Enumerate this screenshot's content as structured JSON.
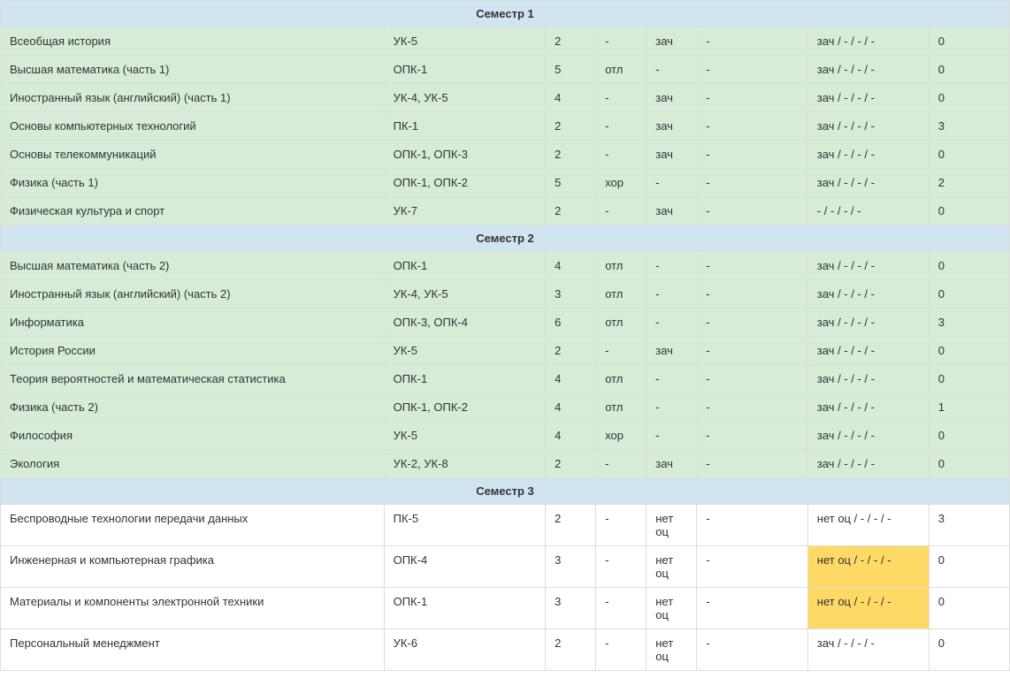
{
  "semesters": [
    {
      "title": "Семестр 1",
      "row_class": "green",
      "rows": [
        {
          "discipline": "Всеобщая история",
          "competence": "УК-5",
          "credits": "2",
          "exam": "-",
          "zach": "зач",
          "extra": "-",
          "summary": "зач / - / - / -",
          "num": "0",
          "summary_highlight": false
        },
        {
          "discipline": "Высшая математика (часть 1)",
          "competence": "ОПК-1",
          "credits": "5",
          "exam": "отл",
          "zach": "-",
          "extra": "-",
          "summary": "зач / - / - / -",
          "num": "0",
          "summary_highlight": false
        },
        {
          "discipline": "Иностранный язык (английский) (часть 1)",
          "competence": "УК-4, УК-5",
          "credits": "4",
          "exam": "-",
          "zach": "зач",
          "extra": "-",
          "summary": "зач / - / - / -",
          "num": "0",
          "summary_highlight": false
        },
        {
          "discipline": "Основы компьютерных технологий",
          "competence": "ПК-1",
          "credits": "2",
          "exam": "-",
          "zach": "зач",
          "extra": "-",
          "summary": "зач / - / - / -",
          "num": "3",
          "summary_highlight": false
        },
        {
          "discipline": "Основы телекоммуникаций",
          "competence": "ОПК-1, ОПК-3",
          "credits": "2",
          "exam": "-",
          "zach": "зач",
          "extra": "-",
          "summary": "зач / - / - / -",
          "num": "0",
          "summary_highlight": false
        },
        {
          "discipline": "Физика (часть 1)",
          "competence": "ОПК-1, ОПК-2",
          "credits": "5",
          "exam": "хор",
          "zach": "-",
          "extra": "-",
          "summary": "зач / - / - / -",
          "num": "2",
          "summary_highlight": false
        },
        {
          "discipline": "Физическая культура и спорт",
          "competence": "УК-7",
          "credits": "2",
          "exam": "-",
          "zach": "зач",
          "extra": "-",
          "summary": "- / - / - / -",
          "num": "0",
          "summary_highlight": false
        }
      ]
    },
    {
      "title": "Семестр 2",
      "row_class": "green",
      "rows": [
        {
          "discipline": "Высшая математика (часть 2)",
          "competence": "ОПК-1",
          "credits": "4",
          "exam": "отл",
          "zach": "-",
          "extra": "-",
          "summary": "зач / - / - / -",
          "num": "0",
          "summary_highlight": false
        },
        {
          "discipline": "Иностранный язык (английский) (часть 2)",
          "competence": "УК-4, УК-5",
          "credits": "3",
          "exam": "отл",
          "zach": "-",
          "extra": "-",
          "summary": "зач / - / - / -",
          "num": "0",
          "summary_highlight": false
        },
        {
          "discipline": "Информатика",
          "competence": "ОПК-3, ОПК-4",
          "credits": "6",
          "exam": "отл",
          "zach": "-",
          "extra": "-",
          "summary": "зач / - / - / -",
          "num": "3",
          "summary_highlight": false
        },
        {
          "discipline": "История России",
          "competence": "УК-5",
          "credits": "2",
          "exam": "-",
          "zach": "зач",
          "extra": "-",
          "summary": "зач / - / - / -",
          "num": "0",
          "summary_highlight": false
        },
        {
          "discipline": "Теория вероятностей и математическая статистика",
          "competence": "ОПК-1",
          "credits": "4",
          "exam": "отл",
          "zach": "-",
          "extra": "-",
          "summary": "зач / - / - / -",
          "num": "0",
          "summary_highlight": false
        },
        {
          "discipline": "Физика (часть 2)",
          "competence": "ОПК-1, ОПК-2",
          "credits": "4",
          "exam": "отл",
          "zach": "-",
          "extra": "-",
          "summary": "зач / - / - / -",
          "num": "1",
          "summary_highlight": false
        },
        {
          "discipline": "Философия",
          "competence": "УК-5",
          "credits": "4",
          "exam": "хор",
          "zach": "-",
          "extra": "-",
          "summary": "зач / - / - / -",
          "num": "0",
          "summary_highlight": false
        },
        {
          "discipline": "Экология",
          "competence": "УК-2, УК-8",
          "credits": "2",
          "exam": "-",
          "zach": "зач",
          "extra": "-",
          "summary": "зач / - / - / -",
          "num": "0",
          "summary_highlight": false
        }
      ]
    },
    {
      "title": "Семестр 3",
      "row_class": "white",
      "rows": [
        {
          "discipline": "Беспроводные технологии передачи данных",
          "competence": "ПК-5",
          "credits": "2",
          "exam": "-",
          "zach": "нет оц",
          "extra": "-",
          "summary": "нет оц / - / - / -",
          "num": "3",
          "summary_highlight": false
        },
        {
          "discipline": "Инженерная и компьютерная графика",
          "competence": "ОПК-4",
          "credits": "3",
          "exam": "-",
          "zach": "нет оц",
          "extra": "-",
          "summary": "нет оц / - / - / -",
          "num": "0",
          "summary_highlight": true
        },
        {
          "discipline": "Материалы и компоненты электронной техники",
          "competence": "ОПК-1",
          "credits": "3",
          "exam": "-",
          "zach": "нет оц",
          "extra": "-",
          "summary": "нет оц / - / - / -",
          "num": "0",
          "summary_highlight": true
        },
        {
          "discipline": "Персональный менеджмент",
          "competence": "УК-6",
          "credits": "2",
          "exam": "-",
          "zach": "нет оц",
          "extra": "-",
          "summary": "зач / - / - / -",
          "num": "0",
          "summary_highlight": false
        }
      ]
    }
  ]
}
